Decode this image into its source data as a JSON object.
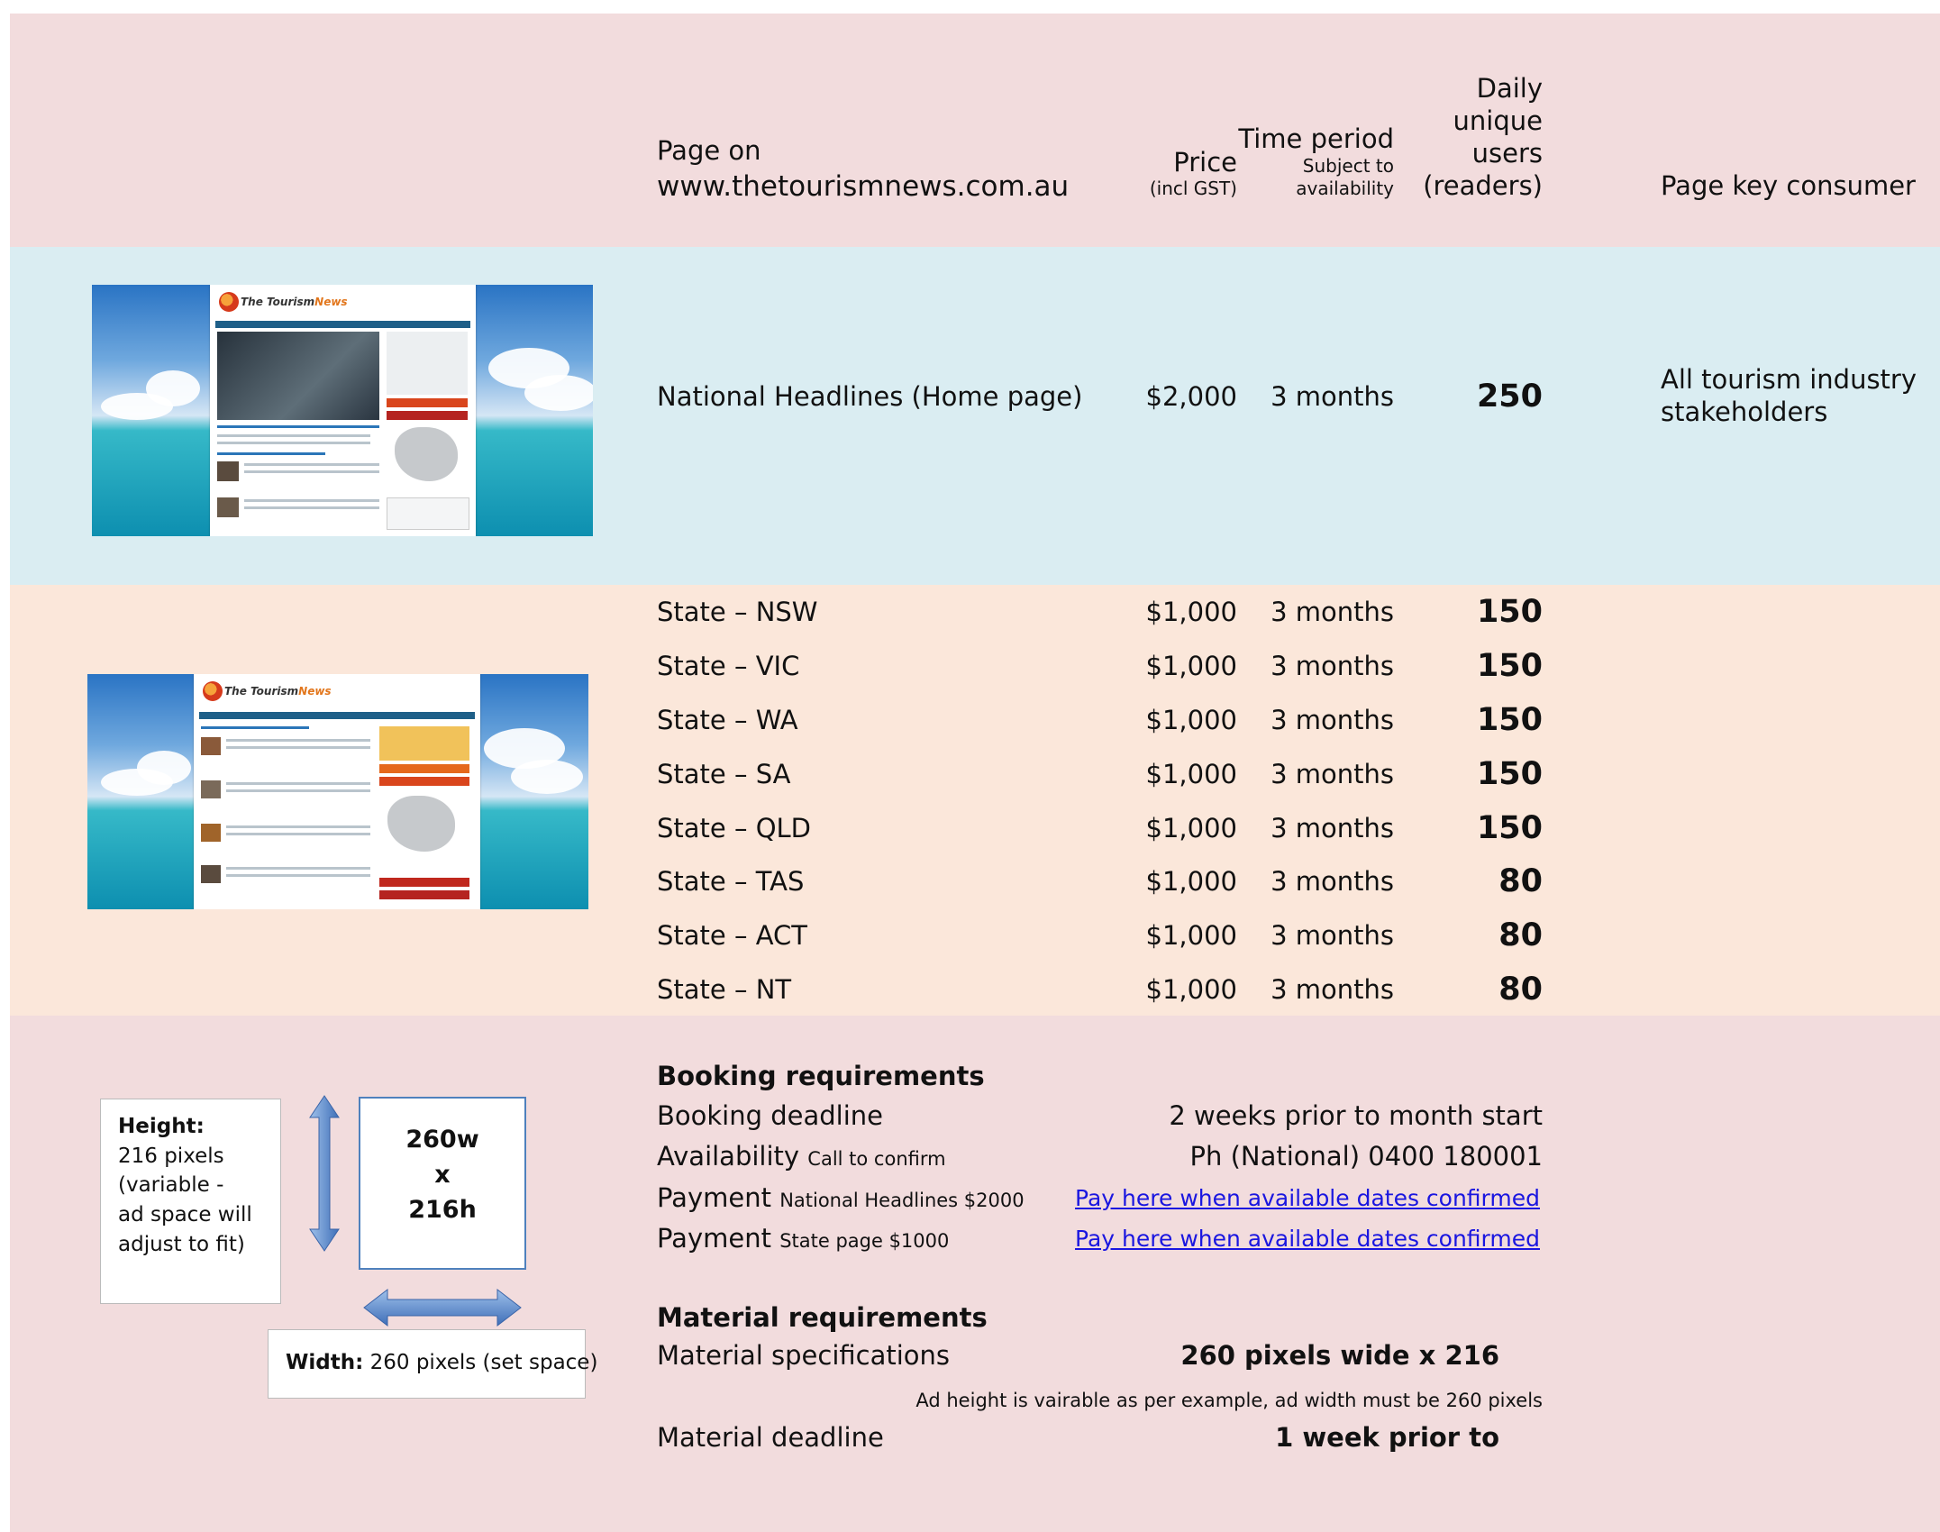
{
  "header": {
    "page_on": "Page on",
    "site": "www.thetourismnews.com.au",
    "price": "Price",
    "price_note": "(incl GST)",
    "time_period": "Time period",
    "time_note_1": "Subject to",
    "time_note_2": "availability",
    "users_1": "Daily",
    "users_2": "unique",
    "users_3": "users",
    "users_4": "(readers)",
    "consumer": "Page key consumer"
  },
  "national": {
    "page": "National Headlines (Home page)",
    "price": "$2,000",
    "period": "3 months",
    "users": "250",
    "consumer_1": "All tourism industry",
    "consumer_2": "stakeholders"
  },
  "states": [
    {
      "page": "State – NSW",
      "price": "$1,000",
      "period": "3 months",
      "users": "150"
    },
    {
      "page": "State – VIC",
      "price": "$1,000",
      "period": "3 months",
      "users": "150"
    },
    {
      "page": "State – WA",
      "price": "$1,000",
      "period": "3 months",
      "users": "150"
    },
    {
      "page": "State – SA",
      "price": "$1,000",
      "period": "3 months",
      "users": "150"
    },
    {
      "page": "State – QLD",
      "price": "$1,000",
      "period": "3 months",
      "users": "150"
    },
    {
      "page": "State – TAS",
      "price": "$1,000",
      "period": "3 months",
      "users": "80"
    },
    {
      "page": "State – ACT",
      "price": "$1,000",
      "period": "3 months",
      "users": "80"
    },
    {
      "page": "State – NT",
      "price": "$1,000",
      "period": "3 months",
      "users": "80"
    }
  ],
  "thumbnails": {
    "logo_text": "The Tourism",
    "logo_accent": "News"
  },
  "booking": {
    "title": "Booking requirements",
    "deadline_label": "Booking deadline",
    "deadline_value": "2 weeks prior to month start",
    "availability_label": "Availability",
    "availability_note": "Call to confirm",
    "availability_value": "Ph (National) 0400 180001",
    "payment_label": "Payment",
    "payment1_note": "National Headlines $2000",
    "payment1_link": "Pay here when available dates confirmed",
    "payment2_note": "State page $1000",
    "payment2_link": "Pay here when available dates confirmed"
  },
  "material": {
    "title": "Material requirements",
    "spec_label": "Material specifications",
    "spec_value": "260 pixels wide x 216",
    "note": "Ad height is vairable as per example, ad width must be 260 pixels",
    "deadline_label": "Material deadline",
    "deadline_value": "1 week prior to"
  },
  "diagram": {
    "height_label": "Height:",
    "height_text_1": "216 pixels",
    "height_text_2": "(variable -",
    "height_text_3": "ad space will",
    "height_text_4": "adjust to fit)",
    "ad_w": "260w",
    "ad_x": "x",
    "ad_h": "216h",
    "width_label": "Width:",
    "width_text": "260 pixels (set space)"
  },
  "colors": {
    "header_band": "#f2dcdd",
    "national_band": "#daedf2",
    "state_band": "#fbe7da",
    "link": "#1a16e0",
    "arrow": "#4f81bd"
  }
}
